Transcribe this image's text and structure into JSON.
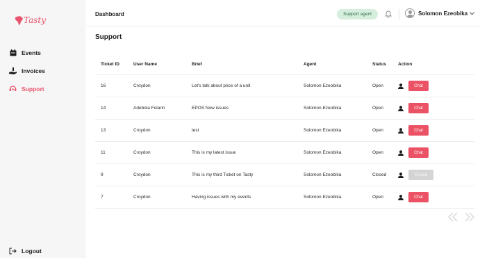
{
  "app": {
    "logo_text": "Tasty",
    "brand_color": "#e8546b"
  },
  "sidebar": {
    "items": [
      {
        "label": "Events",
        "icon": "calendar-icon"
      },
      {
        "label": "Invoices",
        "icon": "hand-money-icon"
      },
      {
        "label": "Support",
        "icon": "headset-icon",
        "active": true
      }
    ],
    "logout_label": "Logout"
  },
  "header": {
    "breadcrumb": "Dashboard",
    "role_badge": "Support agent",
    "user_name": "Solomon Ezeobika"
  },
  "main": {
    "title": "Support",
    "columns": [
      "Ticket ID",
      "User Name",
      "Brief",
      "Agent",
      "Status",
      "Action"
    ],
    "rows": [
      {
        "id": "16",
        "user": "Croydon",
        "brief": "Let's talk about price of a unit",
        "agent": "Solomon Ezeobika",
        "status": "Open",
        "action": "Chat"
      },
      {
        "id": "14",
        "user": "Adebola Folarin",
        "brief": "EPOS Now issues",
        "agent": "Solomon Ezeobika",
        "status": "Open",
        "action": "Chat"
      },
      {
        "id": "13",
        "user": "Croydon",
        "brief": "test",
        "agent": "Solomon Ezeobika",
        "status": "Open",
        "action": "Chat"
      },
      {
        "id": "11",
        "user": "Croydon",
        "brief": "This is my latest issue",
        "agent": "Solomon Ezeobika",
        "status": "Open",
        "action": "Chat"
      },
      {
        "id": "9",
        "user": "Croydon",
        "brief": "This is my third Ticket on Tasty",
        "agent": "Solomon Ezeobika",
        "status": "Closed",
        "action": "Closed"
      },
      {
        "id": "7",
        "user": "Croydon",
        "brief": "Having issues with my events",
        "agent": "Solomon Ezeobika",
        "status": "Open",
        "action": "Chat"
      }
    ]
  }
}
